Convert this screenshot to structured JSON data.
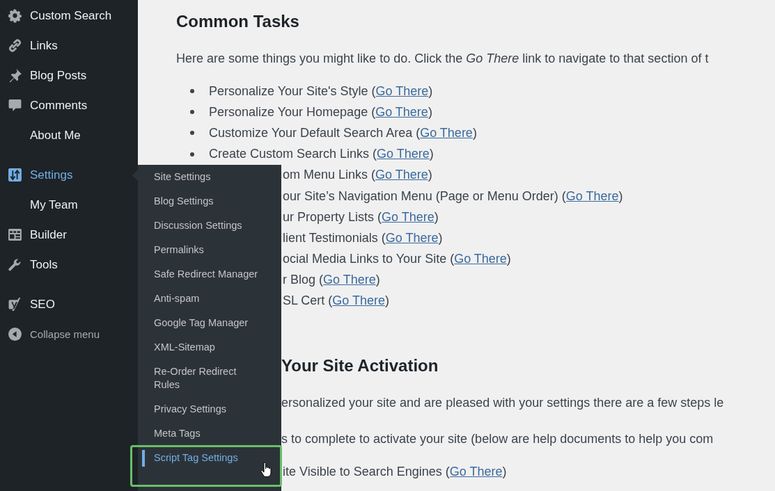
{
  "sidebar": {
    "groups": [
      [
        {
          "label": "Custom Search",
          "kind": "gear",
          "selected": false
        },
        {
          "label": "Links",
          "kind": "link",
          "selected": false
        },
        {
          "label": "Blog Posts",
          "kind": "pin",
          "selected": false
        },
        {
          "label": "Comments",
          "kind": "comment",
          "selected": false
        },
        {
          "label": "About Me",
          "kind": "plain",
          "selected": false
        }
      ],
      [
        {
          "label": "Settings",
          "kind": "settings",
          "selected": true
        },
        {
          "label": "My Team",
          "kind": "plain",
          "selected": false
        },
        {
          "label": "Builder",
          "kind": "builder",
          "selected": false
        },
        {
          "label": "Tools",
          "kind": "tools",
          "selected": false
        }
      ],
      [
        {
          "label": "SEO",
          "kind": "seo",
          "selected": false
        },
        {
          "label": "Collapse menu",
          "kind": "collapse",
          "selected": false
        }
      ]
    ]
  },
  "submenu": {
    "items": [
      {
        "label": "Site Settings",
        "selected": false
      },
      {
        "label": "Blog Settings",
        "selected": false
      },
      {
        "label": "Discussion Settings",
        "selected": false
      },
      {
        "label": "Permalinks",
        "selected": false
      },
      {
        "label": "Safe Redirect Manager",
        "selected": false
      },
      {
        "label": "Anti-spam",
        "selected": false
      },
      {
        "label": "Google Tag Manager",
        "selected": false
      },
      {
        "label": "XML-Sitemap",
        "selected": false
      },
      {
        "label": "Re-Order Redirect Rules",
        "selected": false
      },
      {
        "label": "Privacy Settings",
        "selected": false
      },
      {
        "label": "Meta Tags",
        "selected": false
      },
      {
        "label": "Script Tag Settings",
        "selected": true
      }
    ]
  },
  "content": {
    "sections": [
      {
        "heading": {
          "text": "Common Tasks",
          "kind": "full"
        },
        "paragraphs": [
          {
            "text": "Here are some things you might like to do. Click the *Go There* link to navigate to that section of t",
            "kind": "full"
          }
        ],
        "items": [
          {
            "text": "Personalize Your Site's Style (",
            "link": "Go There",
            "after": ")",
            "kind": "full"
          },
          {
            "text": "Personalize Your Homepage (",
            "link": "Go There",
            "after": ")",
            "kind": "full"
          },
          {
            "text": "Customize Your Default Search Area (",
            "link": "Go There",
            "after": ")",
            "kind": "full"
          },
          {
            "text": "Create Custom Search Links (",
            "link": "Go There",
            "after": ")",
            "kind": "full"
          },
          {
            "text": "om Menu Links (",
            "link": "Go There",
            "after": ")",
            "kind": "clipped"
          },
          {
            "text": "our Site’s Navigation Menu (Page or Menu Order) (",
            "link": "Go There",
            "after": ")",
            "kind": "clipped"
          },
          {
            "text": "ur Property Lists (",
            "link": "Go There",
            "after": ")",
            "kind": "clipped"
          },
          {
            "text": "lient Testimonials (",
            "link": "Go There",
            "after": ")",
            "kind": "clipped"
          },
          {
            "text": "ocial Media Links to Your Site (",
            "link": "Go There",
            "after": ")",
            "kind": "clipped"
          },
          {
            "text": "r Blog (",
            "link": "Go There",
            "after": ")",
            "kind": "clipped"
          },
          {
            "text": "SL Cert (",
            "link": "Go There",
            "after": ")",
            "kind": "clipped"
          }
        ]
      },
      {
        "heading": {
          "text": "Your Site Activation",
          "kind": "clipped"
        },
        "paragraphs": [
          {
            "text": "ersonalized your site and are pleased with your settings there are a few steps le",
            "kind": "clipped"
          },
          {
            "text": "s to complete to activate your site (below are help documents to help you com",
            "kind": "clipped"
          }
        ],
        "items": [
          {
            "text": "ite Visible to Search Engines (",
            "link": "Go There",
            "after": ")",
            "kind": "clipped"
          }
        ]
      }
    ]
  }
}
